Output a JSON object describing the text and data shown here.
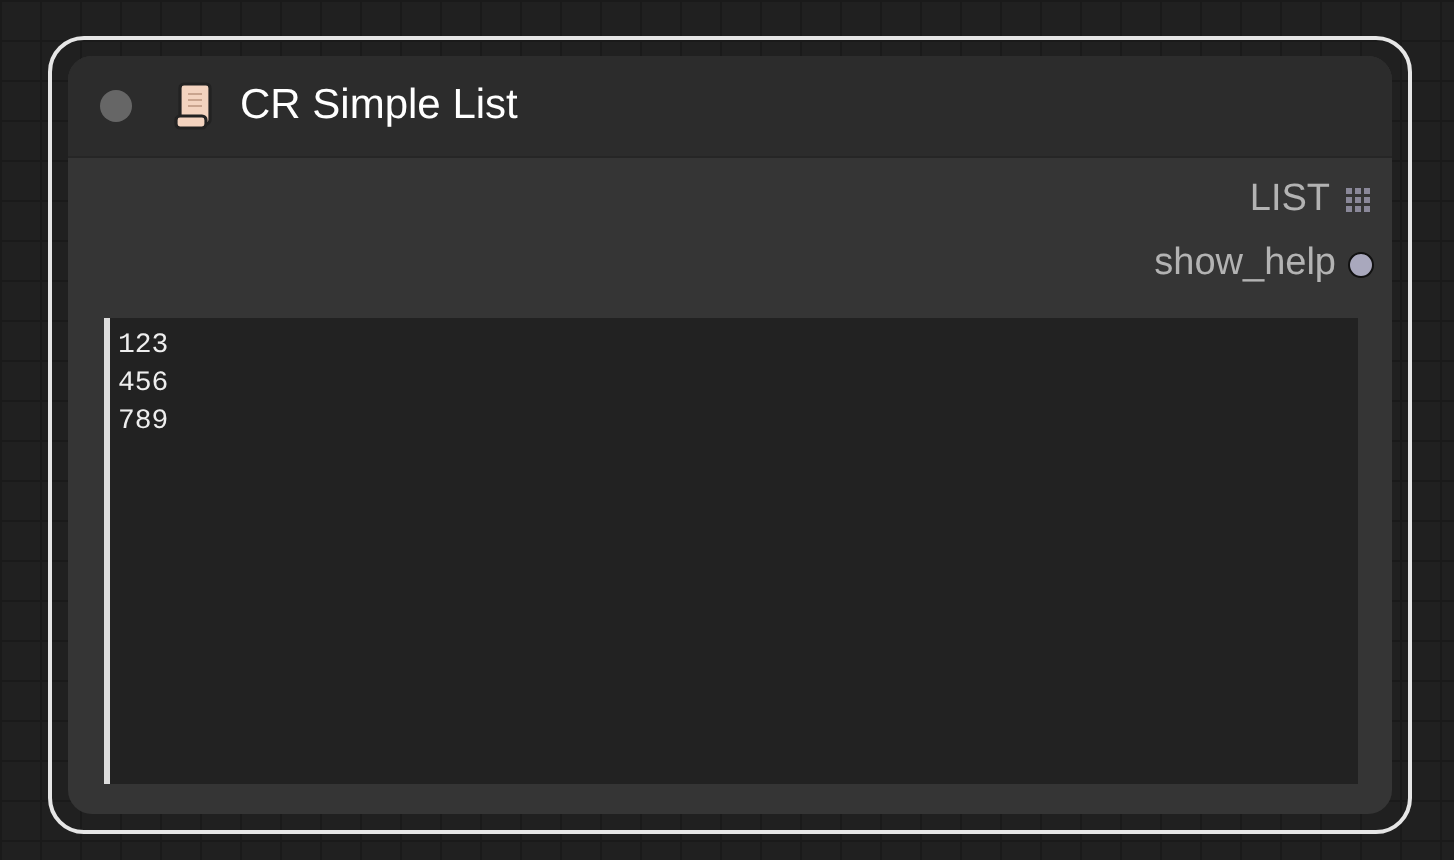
{
  "node": {
    "title": "CR Simple List",
    "selected": true,
    "outputs": [
      {
        "name": "LIST",
        "kind": "grid"
      },
      {
        "name": "show_help",
        "kind": "dot"
      }
    ],
    "text_value": "123\n456\n789"
  }
}
